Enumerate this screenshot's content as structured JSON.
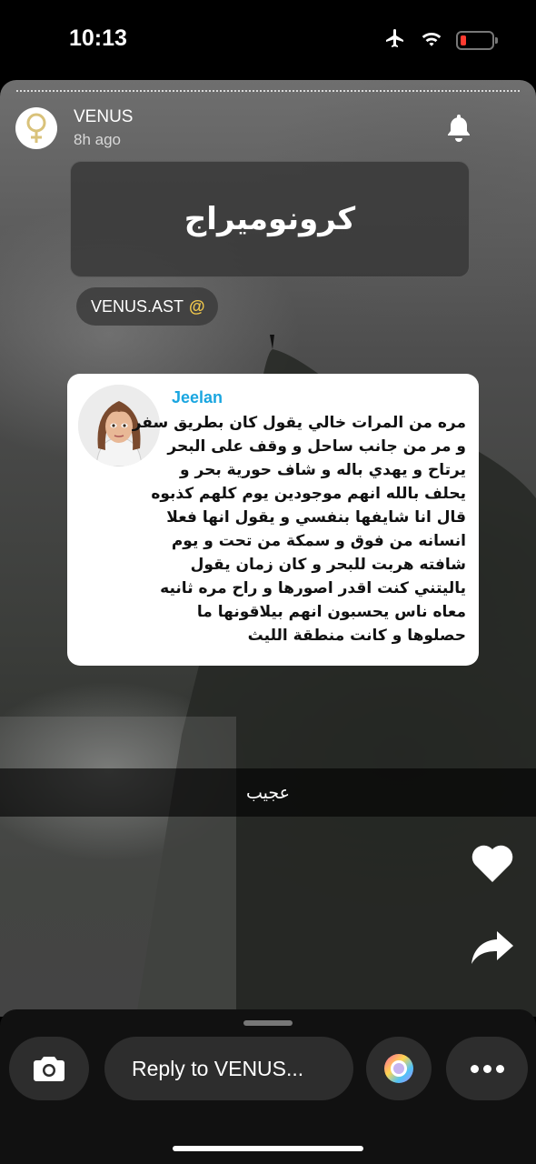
{
  "status_bar": {
    "time": "10:13",
    "icons": [
      "airplane-icon",
      "wifi-icon",
      "battery-low-icon"
    ]
  },
  "story": {
    "user_name": "VENUS",
    "time_ago": "8h ago",
    "title": "كرونوميراج",
    "mention": {
      "at": "@",
      "handle": "VENUS.AST"
    },
    "quote_card": {
      "name": "Jeelan",
      "lines": [
        "مره من المرات خالي يقول كان بطريق سفر",
        "و مر من جانب ساحل و وقف على البحر",
        "يرتاح و يهدي باله و شاف حورية بحر و",
        "يحلف بالله انهم موجودين يوم كلهم كذبوه",
        "قال انا شايفها بنفسي و يقول انها فعلا",
        "انسانه من فوق و سمكة من تحت و يوم",
        "شافته هربت للبحر و كان زمان يقول",
        "ياليتني كنت اقدر اصورها و راح مره ثانيه",
        "معاه ناس يحسبون انهم بيلاقونها ما",
        "حصلوها و كانت منطقة الليث"
      ]
    },
    "caption": "عجيب"
  },
  "reply_bar": {
    "placeholder": "Reply to VENUS..."
  },
  "colors": {
    "accent_name": "#1aa6e0",
    "mention_at": "#f2c94c",
    "battery": "#ff3b30"
  }
}
